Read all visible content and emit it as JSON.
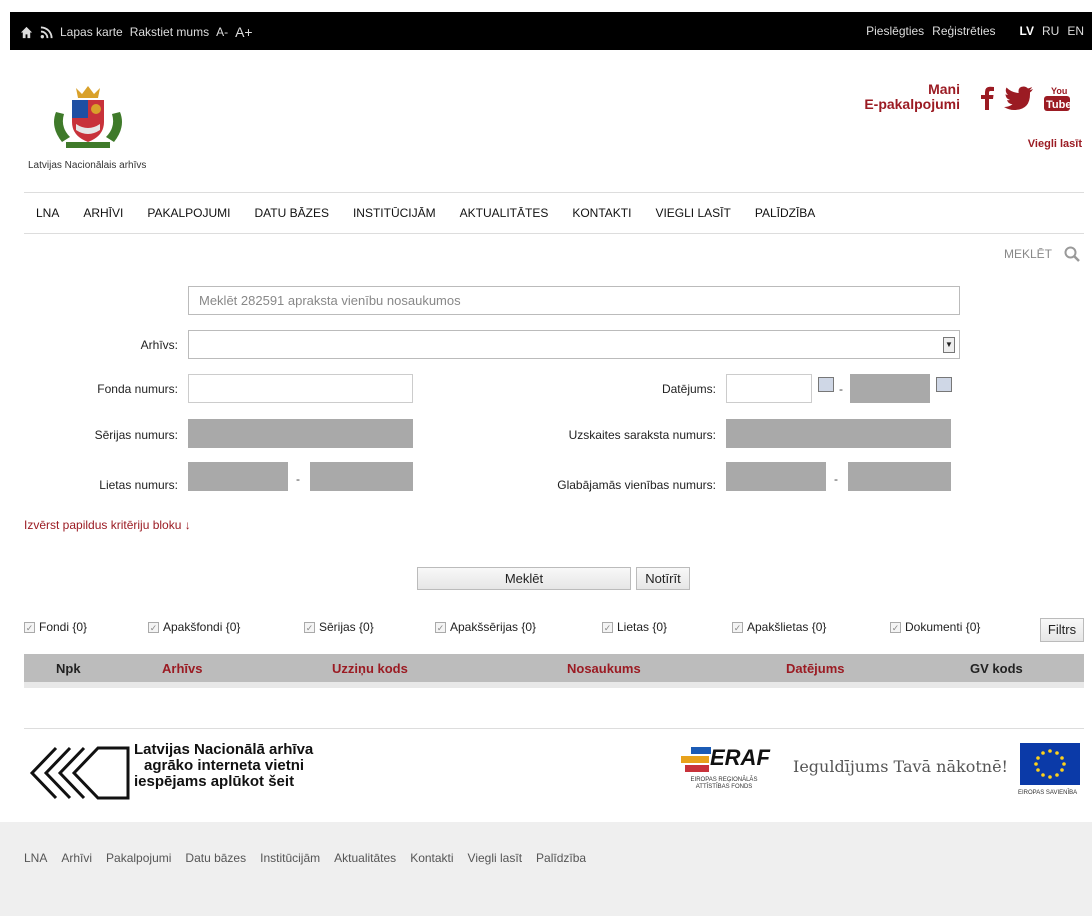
{
  "topbar": {
    "lapas_karte": "Lapas karte",
    "rakstiet": "Rakstiet mums",
    "font_minus": "A-",
    "font_plus": "A+",
    "pieslegties": "Pieslēgties",
    "registreties": "Reģistrēties",
    "lang_lv": "LV",
    "lang_ru": "RU",
    "lang_en": "EN"
  },
  "header": {
    "logo_text": "Latvijas Nacionālais arhīvs",
    "mani_line1": "Mani",
    "mani_line2": "E-pakalpojumi",
    "viegli_lasit": "Viegli lasīt"
  },
  "nav": [
    "LNA",
    "ARHĪVI",
    "PAKALPOJUMI",
    "DATU BĀZES",
    "INSTITŪCIJĀM",
    "AKTUALITĀTES",
    "KONTAKTI",
    "VIEGLI LASĪT",
    "PALĪDZĪBA"
  ],
  "search": {
    "top_label": "MEKLĒT",
    "placeholder": "Meklēt 282591 apraksta vienību nosaukumos"
  },
  "form": {
    "arhivs": "Arhīvs:",
    "fonda_numurs": "Fonda numurs:",
    "serijas_numurs": "Sērijas numurs:",
    "lietas_numurs": "Lietas numurs:",
    "datejums": "Datējums:",
    "uzskaites": "Uzskaites saraksta numurs:",
    "glabajamas": "Glabājamās vienības numurs:",
    "dash": "-",
    "expand": "Izvērst papildus kritēriju bloku ↓",
    "meklet_btn": "Meklēt",
    "notirit_btn": "Notīrīt"
  },
  "filters": {
    "items": [
      "Fondi {0}",
      "Apakšfondi {0}",
      "Sērijas {0}",
      "Apakšsērijas {0}",
      "Lietas {0}",
      "Apakšlietas {0}",
      "Dokumenti {0}"
    ],
    "filtrs_btn": "Filtrs"
  },
  "table": {
    "headers": [
      "Npk",
      "Arhīvs",
      "Uzziņu kods",
      "Nosaukums",
      "Datējums",
      "GV kods"
    ]
  },
  "bottom": {
    "old_line1": "Latvijas Nacionālā arhīva",
    "old_line2": "agrāko interneta vietni",
    "old_line3": "iespējams aplūkot šeit",
    "eraf_big": "ERAF",
    "eraf_small1": "EIROPAS REĢIONĀLĀS",
    "eraf_small2": "ATTĪSTĪBAS FONDS",
    "ieguldijums": "Ieguldījums Tavā nākotnē!",
    "eu_small": "EIROPAS SAVIENĪBA"
  },
  "footer": [
    "LNA",
    "Arhīvi",
    "Pakalpojumi",
    "Datu bāzes",
    "Institūcijām",
    "Aktualitātes",
    "Kontakti",
    "Viegli lasīt",
    "Palīdzība"
  ],
  "colors": {
    "accent": "#9b1b23",
    "topbar": "#000000",
    "gray_field": "#a9a9a9"
  }
}
